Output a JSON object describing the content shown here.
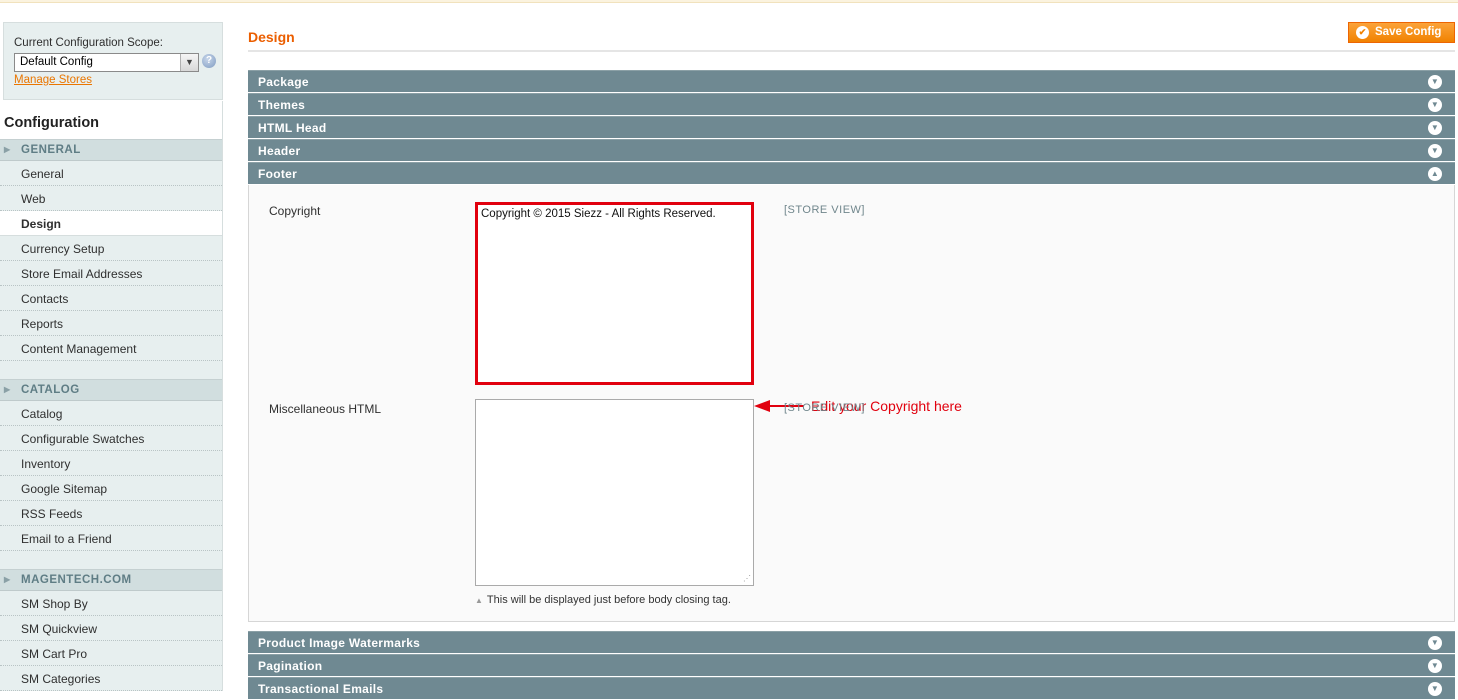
{
  "sidebar": {
    "scope_label": "Current Configuration Scope:",
    "scope_value": "Default Config",
    "manage_stores": "Manage Stores",
    "config_title": "Configuration",
    "groups": [
      {
        "label": "GENERAL",
        "items": [
          "General",
          "Web",
          "Design",
          "Currency Setup",
          "Store Email Addresses",
          "Contacts",
          "Reports",
          "Content Management"
        ]
      },
      {
        "label": "CATALOG",
        "items": [
          "Catalog",
          "Configurable Swatches",
          "Inventory",
          "Google Sitemap",
          "RSS Feeds",
          "Email to a Friend"
        ]
      },
      {
        "label": "MAGENTECH.COM",
        "items": [
          "SM Shop By",
          "SM Quickview",
          "SM Cart Pro",
          "SM Categories"
        ]
      }
    ],
    "active_item": "Design"
  },
  "main": {
    "title": "Design",
    "save_button": "Save Config",
    "sections": {
      "package": "Package",
      "themes": "Themes",
      "html_head": "HTML Head",
      "header": "Header",
      "footer": "Footer",
      "watermarks": "Product Image Watermarks",
      "pagination": "Pagination",
      "transactional": "Transactional Emails"
    },
    "footer": {
      "copyright_label": "Copyright",
      "copyright_value": "Copyright ©  2015 Siezz - All Rights Reserved.",
      "copyright_scope": "[STORE VIEW]",
      "misc_label": "Miscellaneous HTML",
      "misc_value": "",
      "misc_scope": "[STORE VIEW]",
      "misc_note": "This will be displayed just before body closing tag."
    },
    "annotation": "Edit your Copyright here"
  },
  "colors": {
    "accent_orange": "#eb5e00",
    "section_header": "#6f8992",
    "highlight_red": "#e1000e",
    "sidebar_bg": "#e7efef"
  },
  "icons": [
    "help-icon",
    "chevron-down-icon",
    "chevron-up-icon",
    "save-icon",
    "arrow-left-icon",
    "resize-grip-icon"
  ]
}
